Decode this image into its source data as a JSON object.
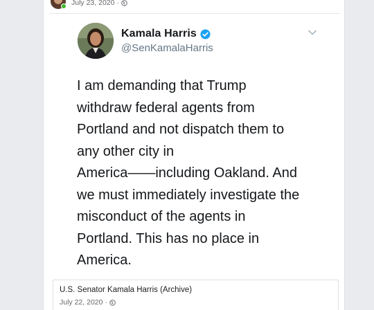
{
  "post": {
    "date": "July 23, 2020",
    "separator": "·"
  },
  "tweet": {
    "name": "Kamala Harris",
    "handle": "@SenKamalaHarris",
    "lines": [
      "I am demanding that Trump",
      "withdraw federal agents from",
      "Portland and not dispatch them to",
      "any other city in",
      "America——including Oakland. And",
      "we must immediately investigate the",
      "misconduct of the agents in",
      "Portland. This has no place in",
      "America."
    ],
    "verified_color": "#1da1f2"
  },
  "link_preview": {
    "title": "U.S. Senator Kamala Harris (Archive)",
    "date": "July 22, 2020",
    "separator": "·"
  },
  "icons": [
    "globe-icon",
    "verified-icon",
    "chevron-down-icon"
  ]
}
